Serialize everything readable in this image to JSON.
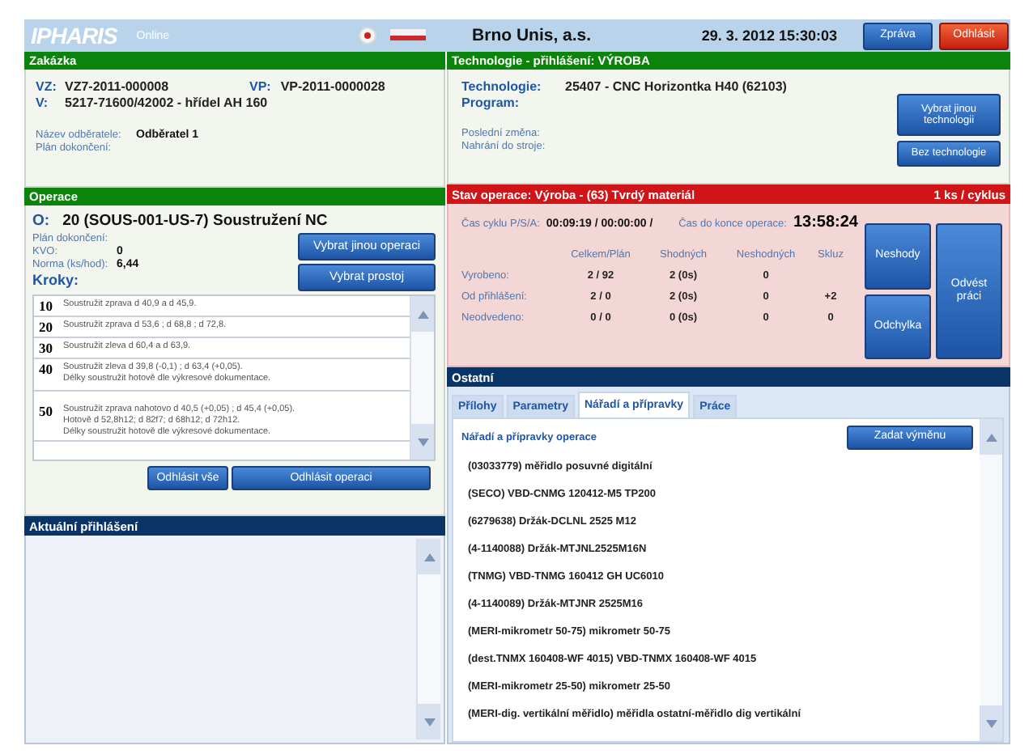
{
  "header": {
    "logo": "IPHARIS",
    "status": "Online",
    "company": "Brno Unis, a.s.",
    "datetime": "29. 3. 2012 15:30:03",
    "buttons": [
      {
        "label": "Zpráva",
        "kind": "primary"
      },
      {
        "label": "Odhlásit",
        "kind": "danger"
      }
    ]
  },
  "order": {
    "title": "Zakázka",
    "vz_label": "VZ:",
    "vz": "VZ7-2011-000008",
    "vp_label": "VP:",
    "vp": "VP-2011-0000028",
    "v_label": "V:",
    "v": "5217-71600/42002 - hřídel AH 160",
    "customer_label": "Název odběratele:",
    "customer": "Odběratel 1",
    "plan_label": "Plán dokončení:"
  },
  "technology": {
    "title": "Technologie - přihlášení: VÝROBA",
    "tech_label": "Technologie:",
    "tech": "25407 - CNC Horizontka H40 (62103)",
    "program_label": "Program:",
    "last_change_label": "Poslední změna:",
    "upload_label": "Nahrání do stroje:",
    "buttons": [
      "Vybrat jinou technologii",
      "Bez technologie"
    ]
  },
  "operation": {
    "title": "Operace",
    "o_label": "O:",
    "o": "20 (SOUS-001-US-7) Soustružení NC",
    "fields": [
      {
        "label": "Plán dokončení:"
      },
      {
        "label": "KVO:",
        "value": "0"
      },
      {
        "label": "Norma (ks/hod):",
        "value": "6,44"
      }
    ],
    "select_buttons": [
      "Vybrat jinou operaci",
      "Vybrat prostoj"
    ],
    "steps_label": "Kroky:",
    "steps": [
      {
        "number": "10",
        "text": "Soustružit zprava d 40,9 a d 45,9."
      },
      {
        "number": "20",
        "text": "Soustružit zprava d 53,6 ; d 68,8 ; d 72,8."
      },
      {
        "number": "30",
        "text": "Soustružit zleva d 60,4 a d 63,9."
      },
      {
        "number": "40",
        "text": "Soustružit zleva d 39,8 (-0,1) ; d 63,4 (+0,05).\nDélky soustružit hotově dle výkresové dokumentace."
      },
      {
        "number": "50",
        "text": "Soustružit zprava nahotovo d 40,5 (+0,05) ; d 45,4 (+0,05).\nHotově d 52,8h12; d 82f7; d 68h12; d 72h12.\nDélky soustružit hotově dle výkresové dokumentace."
      }
    ],
    "logout_buttons": [
      "Odhlásit vše",
      "Odhlásit operaci"
    ]
  },
  "status": {
    "title": "Stav operace: Výroba - (63) Tvrdý materiál",
    "rate": "1 ks / cyklus",
    "cycle_label": "Čas cyklu P/S/A:",
    "cycle": "00:09:19 / 00:00:00 /",
    "remaining_label": "Čas do konce operace:",
    "remaining": "13:58:24",
    "columns": [
      "Celkem/Plán",
      "Shodných",
      "Neshodných",
      "Skluz"
    ],
    "rows": [
      {
        "label": "Vyrobeno:",
        "cells": [
          "2 / 92",
          "2 (0s)",
          "0"
        ]
      },
      {
        "label": "Od přihlášení:",
        "cells": [
          "2 / 0",
          "2 (0s)",
          "0",
          "+2"
        ]
      },
      {
        "label": "Neodvedeno:",
        "cells": [
          "0 / 0",
          "0 (0s)",
          "0",
          "0"
        ]
      }
    ],
    "buttons": [
      "Neshody",
      "Odchylka",
      "Odvést práci"
    ]
  },
  "other": {
    "title": "Ostatní",
    "tabs": [
      {
        "label": "Přílohy",
        "selected": false
      },
      {
        "label": "Parametry",
        "selected": false
      },
      {
        "label": "Nářadí a přípravky",
        "selected": true
      },
      {
        "label": "Práce",
        "selected": false
      }
    ],
    "list_title": "Nářadí a přípravky operace",
    "action": "Zadat výměnu",
    "items": [
      "(03033779) měřidlo posuvné digitální",
      "(SECO) VBD-CNMG 120412-M5 TP200",
      "(6279638) Držák-DCLNL 2525 M12",
      "(4-1140088) Držák-MTJNL2525M16N",
      "(TNMG) VBD-TNMG 160412 GH UC6010",
      "(4-1140089) Držák-MTJNR 2525M16",
      "(MERI-mikrometr 50-75) mikrometr 50-75",
      "(dest.TNMX 160408-WF 4015) VBD-TNMX 160408-WF 4015",
      "(MERI-mikrometr 25-50) mikrometr 25-50",
      "(MERI-dig. vertikální měřidlo) měřidla ostatní-měřidlo dig vertikální"
    ]
  },
  "login": {
    "title": "Aktuální přihlášení"
  }
}
